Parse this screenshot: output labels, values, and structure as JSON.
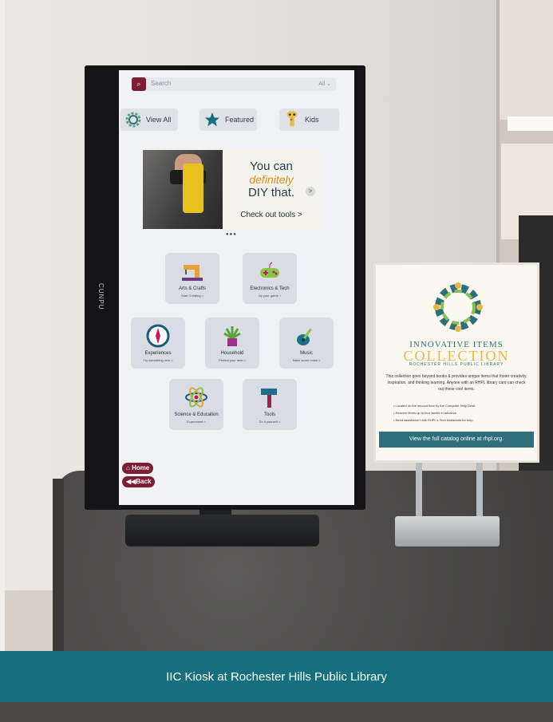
{
  "kiosk": {
    "brand": "CUNPU",
    "search": {
      "placeholder": "Search",
      "scope": "All"
    },
    "quick_links": [
      {
        "label": "View All",
        "icon": "gear-icon"
      },
      {
        "label": "Featured",
        "icon": "star-icon"
      },
      {
        "label": "Kids",
        "icon": "giraffe-icon"
      }
    ],
    "banner": {
      "line1": "You can",
      "line2": "definitely",
      "line3": "DIY that.",
      "cta": "Check out tools >",
      "next": ">",
      "dots": "●●●"
    },
    "categories": [
      {
        "title": "Arts & Crafts",
        "subtitle": "Start Creating >",
        "icon": "sewing-machine-icon"
      },
      {
        "title": "Electronics & Tech",
        "subtitle": "Up your game >",
        "icon": "game-controller-icon"
      },
      {
        "title": "Experiences",
        "subtitle": "Try something new >",
        "icon": "compass-icon"
      },
      {
        "title": "Household",
        "subtitle": "Perfect your nest >",
        "icon": "potted-plant-icon"
      },
      {
        "title": "Music",
        "subtitle": "Make some noise >",
        "icon": "guitar-icon"
      },
      {
        "title": "Science & Education",
        "subtitle": "Experiment >",
        "icon": "atom-icon"
      },
      {
        "title": "Tools",
        "subtitle": "Do it yourself >",
        "icon": "hammer-icon"
      }
    ],
    "nav": {
      "home": "Home",
      "back": "Back"
    }
  },
  "sign": {
    "title_line1": "INNOVATIVE ITEMS",
    "title_line2": "COLLECTION",
    "subtitle": "ROCHESTER HILLS PUBLIC LIBRARY",
    "body": "This collection goes beyond books & provides unique items that foster creativity, inspiration, and thinking learning. Anyone with an RHPL library card can check out these cool items.",
    "bullets": [
      "Located on the second floor by the Computer Help Desk.",
      "Reserve items up to four weeks in advance.",
      "Need assistance? Ask RHPL's Tech Assistants for help."
    ],
    "footer": "View the full catalog online at rhpl.org."
  },
  "caption": "IIC Kiosk at Rochester Hills Public Library",
  "colors": {
    "accent": "#7b1d35",
    "teal": "#14707e",
    "gold": "#e3b74c"
  }
}
